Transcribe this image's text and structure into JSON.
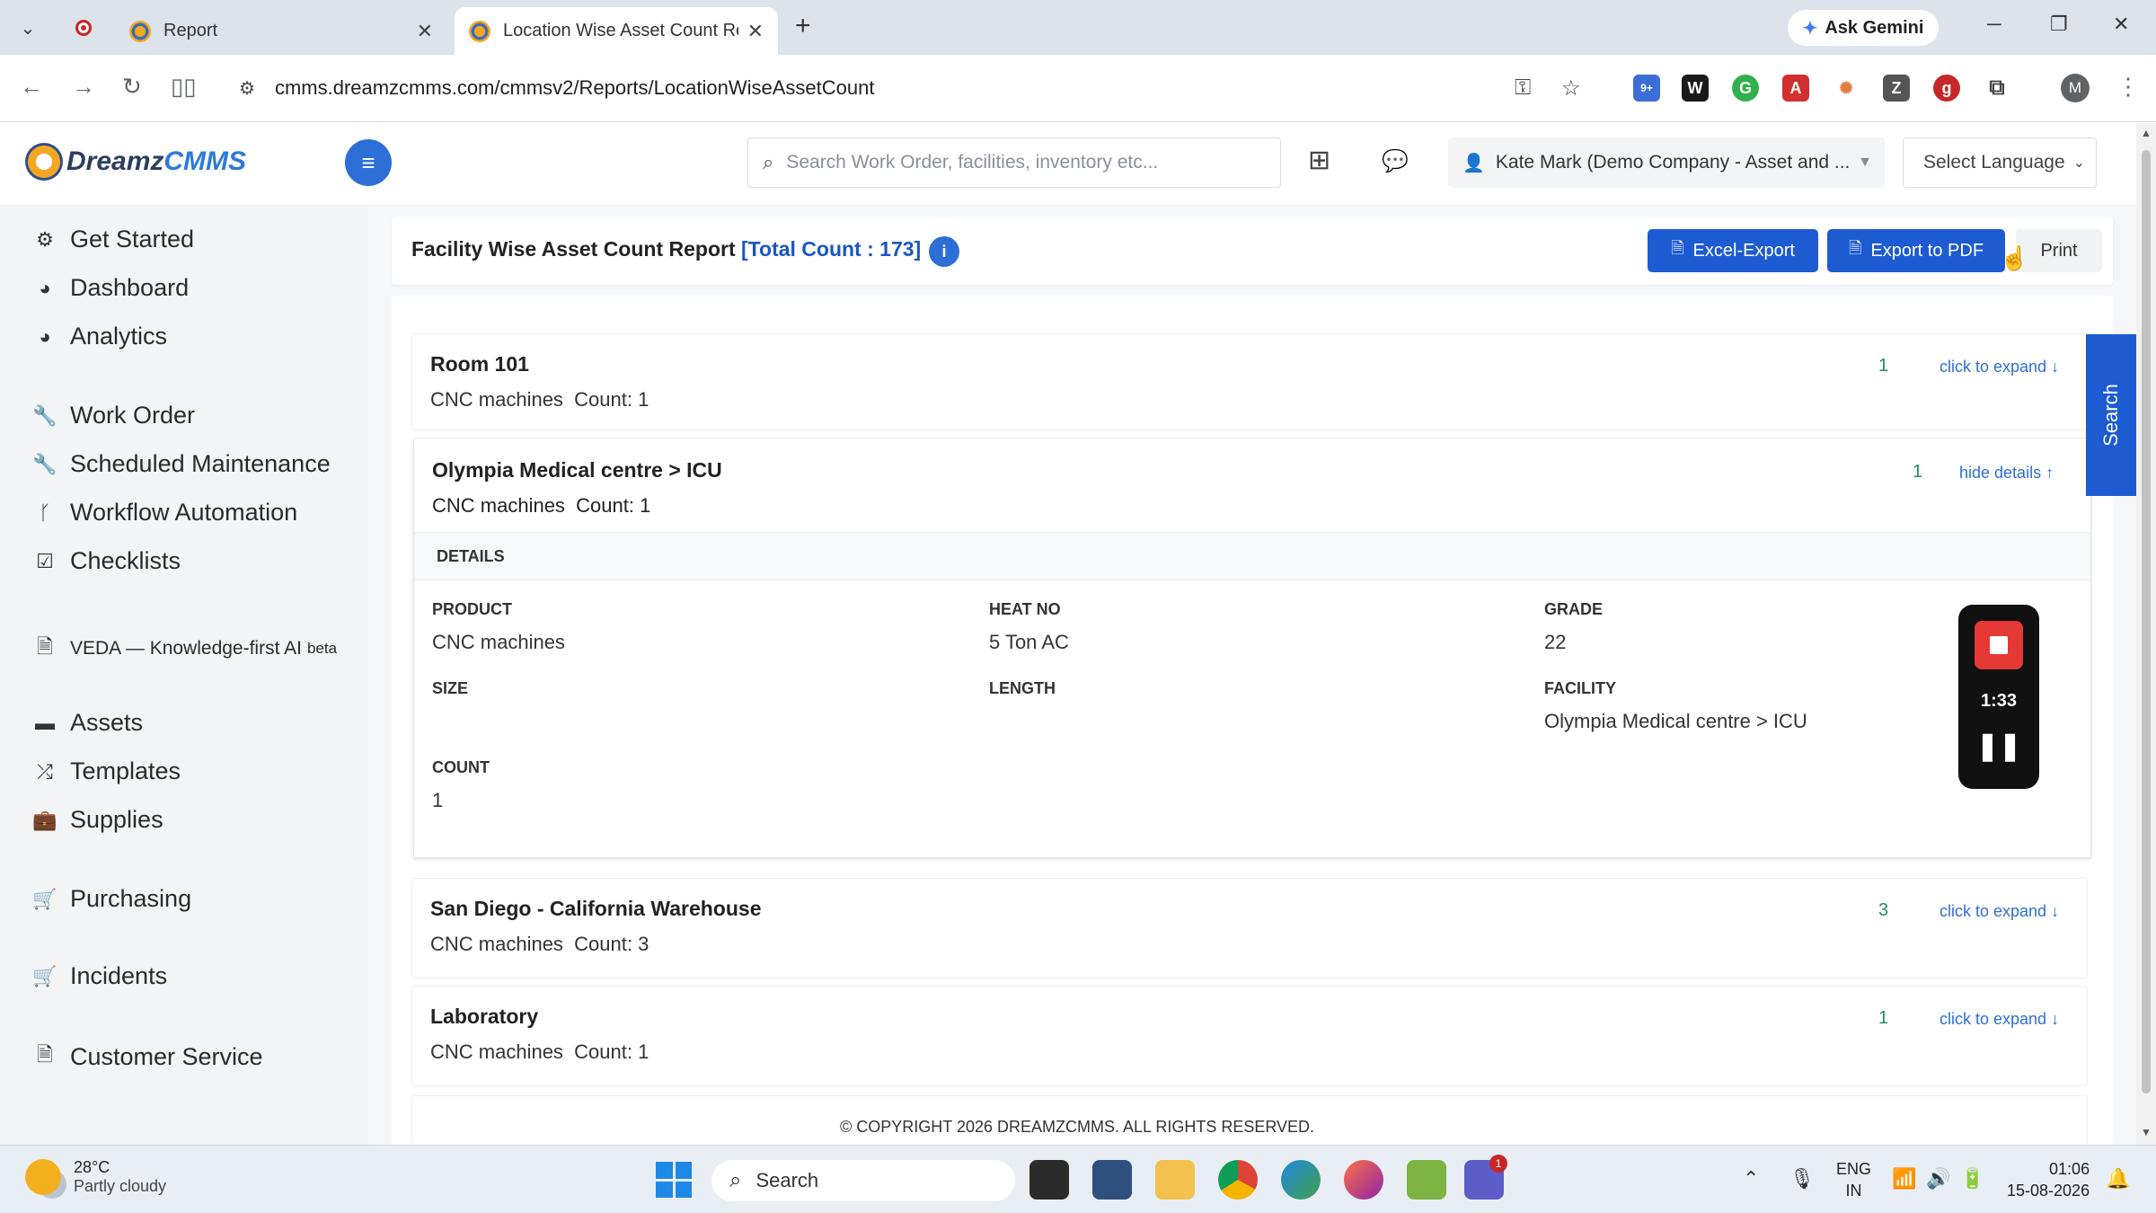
{
  "browser": {
    "tabs": [
      {
        "title": "Report",
        "active": false
      },
      {
        "title": "Location Wise Asset Count Rep",
        "active": true
      }
    ],
    "ask_gemini": "Ask Gemini",
    "url": "cmms.dreamzcmms.com/cmmsv2/Reports/LocationWiseAssetCount",
    "profile_initial": "M",
    "extension_badge": "9+"
  },
  "app": {
    "logo_text_1": "Dreamz",
    "logo_text_2": "CMMS",
    "search_placeholder": "Search Work Order, facilities, inventory etc...",
    "user_label": "Kate Mark (Demo Company - Asset and ...",
    "language_select": "Select Language"
  },
  "sidebar": {
    "items": [
      {
        "label": "Get Started",
        "icon": "gears-icon"
      },
      {
        "label": "Dashboard",
        "icon": "gauge-icon"
      },
      {
        "label": "Analytics",
        "icon": "gauge-icon"
      },
      {
        "label": "Work Order",
        "icon": "wrench-icon"
      },
      {
        "label": "Scheduled Maintenance",
        "icon": "wrench-icon"
      },
      {
        "label": "Workflow Automation",
        "icon": "branch-icon"
      },
      {
        "label": "Checklists",
        "icon": "checkbox-icon"
      },
      {
        "label": "VEDA — Knowledge-first AI",
        "badge": "beta",
        "icon": "file-icon"
      },
      {
        "label": "Assets",
        "icon": "box-icon"
      },
      {
        "label": "Templates",
        "icon": "shuffle-icon"
      },
      {
        "label": "Supplies",
        "icon": "briefcase-icon"
      },
      {
        "label": "Purchasing",
        "icon": "cart-icon"
      },
      {
        "label": "Incidents",
        "icon": "cart-icon"
      },
      {
        "label": "Customer Service",
        "icon": "file-icon"
      }
    ]
  },
  "report": {
    "title": "Facility Wise Asset Count Report",
    "total": "[Total Count : 173]",
    "buttons": {
      "excel": "Excel-Export",
      "pdf": "Export to PDF",
      "print": "Print"
    },
    "rows": [
      {
        "location": "Room 101",
        "summary": "CNC machines  Count: 1",
        "count": "1",
        "toggle": "click to expand ↓"
      },
      {
        "location": "Olympia Medical centre > ICU",
        "summary": "CNC machines  Count: 1",
        "count": "1",
        "toggle": "hide details ↑"
      },
      {
        "location": "San Diego - California Warehouse",
        "summary": "CNC machines  Count: 3",
        "count": "3",
        "toggle": "click to expand ↓"
      },
      {
        "location": "Laboratory",
        "summary": "CNC machines  Count: 1",
        "count": "1",
        "toggle": "click to expand ↓"
      }
    ],
    "details": {
      "header": "DETAILS",
      "product_label": "PRODUCT",
      "product_value": "CNC machines",
      "heat_label": "HEAT NO",
      "heat_value": "5 Ton AC",
      "grade_label": "GRADE",
      "grade_value": "22",
      "size_label": "SIZE",
      "size_value": "",
      "length_label": "LENGTH",
      "length_value": "",
      "facility_label": "FACILITY",
      "facility_value": "Olympia Medical centre > ICU",
      "count_label": "COUNT",
      "count_value": "1"
    },
    "side_tab": "Search",
    "copyright": "© COPYRIGHT 2026 DREAMZCMMS. ALL RIGHTS RESERVED."
  },
  "recorder": {
    "time": "1:33"
  },
  "taskbar": {
    "weather_temp": "28°C",
    "weather_desc": "Partly cloudy",
    "search": "Search",
    "lang_1": "ENG",
    "lang_2": "IN",
    "time": "01:06",
    "date": "15-08-2026",
    "teams_badge": "1"
  },
  "colors": {
    "primary": "#1d5bd3",
    "count_green": "#1f8f5a",
    "link_blue": "#2d6fd6",
    "sidebar_bg": "#f3f4f6"
  }
}
